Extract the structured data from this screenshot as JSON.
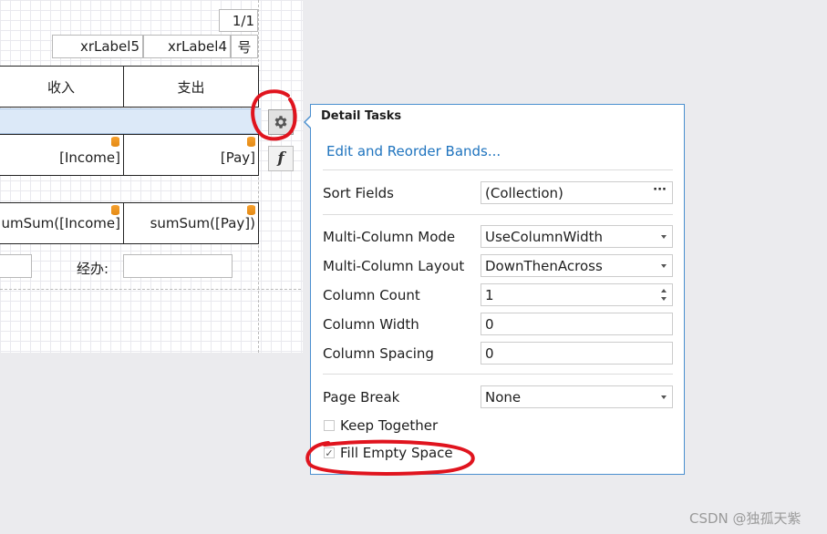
{
  "design": {
    "page_number": "1/1",
    "labels": [
      "xrLabel5",
      "xrLabel4",
      "号"
    ],
    "headers": [
      "收入",
      "支出"
    ],
    "detail_fields": [
      "[Income]",
      "[Pay]"
    ],
    "summary_fields": [
      "umSum([Income]",
      "sumSum([Pay])"
    ],
    "handler_label": "经办:"
  },
  "smart_tags": {
    "tasks_icon": "gear-icon",
    "expression_icon": "fx-icon",
    "expression_glyph": "f"
  },
  "panel": {
    "title": "Detail Tasks",
    "link": "Edit and Reorder Bands...",
    "sort_fields": {
      "label": "Sort Fields",
      "value": "(Collection)",
      "button": "···"
    },
    "multi_column_mode": {
      "label": "Multi-Column Mode",
      "value": "UseColumnWidth"
    },
    "multi_column_layout": {
      "label": "Multi-Column Layout",
      "value": "DownThenAcross"
    },
    "column_count": {
      "label": "Column Count",
      "value": "1"
    },
    "column_width": {
      "label": "Column Width",
      "value": "0"
    },
    "column_spacing": {
      "label": "Column Spacing",
      "value": "0"
    },
    "page_break": {
      "label": "Page Break",
      "value": "None"
    },
    "keep_together": {
      "label": "Keep Together",
      "checked": false
    },
    "fill_empty_space": {
      "label": "Fill Empty Space",
      "checked": true,
      "check_glyph": "✓"
    }
  },
  "watermark": "CSDN @独孤天紫",
  "colors": {
    "accent": "#1e73be",
    "panel_border": "#4a8fcf",
    "band_highlight": "#dce9f8",
    "annotation": "#e0141e"
  }
}
